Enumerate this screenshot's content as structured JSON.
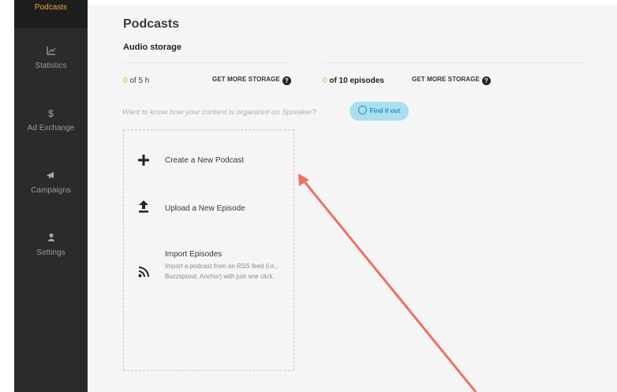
{
  "sidebar": {
    "active_item": "Podcasts",
    "items": [
      {
        "label": "Statistics",
        "icon": "chart-icon"
      },
      {
        "label": "Ad Exchange",
        "icon": "dollar-icon"
      },
      {
        "label": "Campaigns",
        "icon": "megaphone-icon"
      },
      {
        "label": "Settings",
        "icon": "user-icon"
      }
    ]
  },
  "page": {
    "title": "Podcasts",
    "section_title": "Audio storage"
  },
  "storage": {
    "audio_used": "0",
    "audio_total": "of 5 h",
    "audio_more": "GET MORE STORAGE",
    "episodes_used": "0",
    "episodes_total": "of 10 episodes",
    "episodes_more": "GET MORE STORAGE",
    "help_glyph": "?"
  },
  "hint": {
    "text": "Want to know how your content is organized on Spreaker?",
    "button": "Find it out"
  },
  "actions": [
    {
      "label": "Create a New Podcast",
      "icon": "plus-icon"
    },
    {
      "label": "Upload a New Episode",
      "icon": "upload-icon"
    },
    {
      "label": "Import Episodes",
      "icon": "rss-icon",
      "description": "Import a podcast from an RSS feed (i.e., Buzzsprout, Anchor) with just one click."
    }
  ],
  "colors": {
    "accent": "#f0a33a",
    "sidebar_bg": "#2b2b2b",
    "find_button_bg": "#a9dff0",
    "annotation_arrow": "#f07060"
  }
}
